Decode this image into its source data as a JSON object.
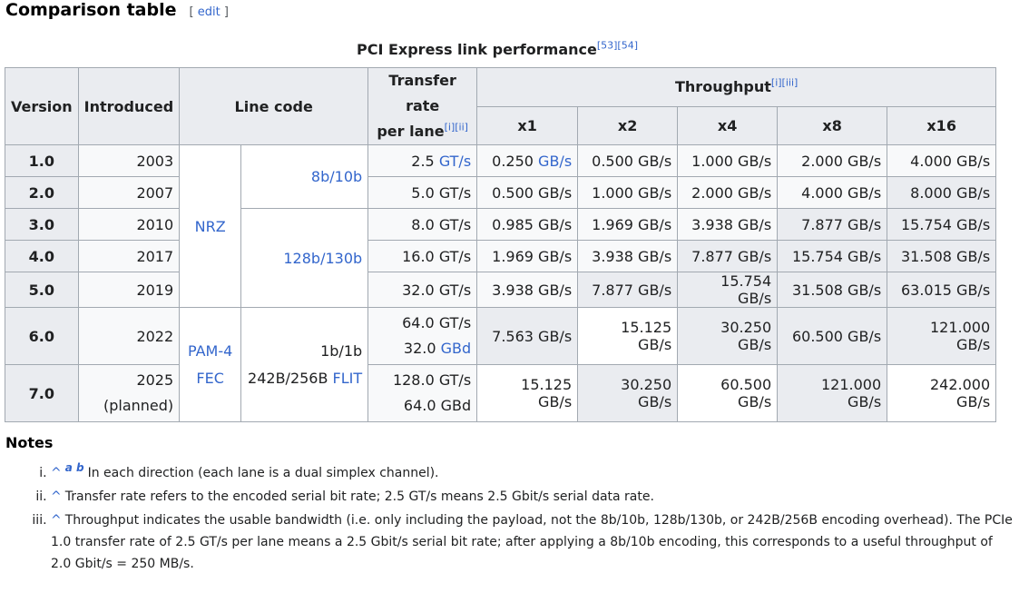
{
  "heading": {
    "title": "Comparison table",
    "edit_open": "[",
    "edit": "edit",
    "edit_close": "]"
  },
  "caption": {
    "text": "PCI Express link performance",
    "refs": "[53][54]"
  },
  "table": {
    "headers": {
      "version": "Version",
      "introduced": "Introduced",
      "line_code": "Line code",
      "transfer_rate_line1": "Transfer rate",
      "transfer_rate_line2": "per lane",
      "transfer_rate_refs": "[i][ii]",
      "throughput": "Throughput",
      "throughput_refs": "[i][iii]",
      "lanes": [
        "x1",
        "x2",
        "x4",
        "x8",
        "x16"
      ]
    },
    "groups": {
      "nrz": "NRZ",
      "pam4": "PAM-4",
      "fec": "FEC",
      "code_8b10b": "8b/10b",
      "code_128b130b": "128b/130b",
      "code_1b1b": "1b/1b",
      "code_242b_prefix": "242B/256B",
      "code_flit": "FLIT"
    },
    "rows": [
      {
        "version": "1.0",
        "year": "2003",
        "rate_num": "2.5",
        "rate_unit": "GT/s",
        "x1_num": "0.250",
        "x1_unit": "GB/s",
        "x2": "0.500 GB/s",
        "x4": "1.000 GB/s",
        "x8": "2.000 GB/s",
        "x16": "4.000 GB/s"
      },
      {
        "version": "2.0",
        "year": "2007",
        "rate": "5.0 GT/s",
        "x1": "0.500 GB/s",
        "x2": "1.000 GB/s",
        "x4": "2.000 GB/s",
        "x8": "4.000 GB/s",
        "x16": "8.000 GB/s"
      },
      {
        "version": "3.0",
        "year": "2010",
        "rate": "8.0 GT/s",
        "x1": "0.985 GB/s",
        "x2": "1.969 GB/s",
        "x4": "3.938 GB/s",
        "x8": "7.877 GB/s",
        "x16": "15.754 GB/s"
      },
      {
        "version": "4.0",
        "year": "2017",
        "rate": "16.0 GT/s",
        "x1": "1.969 GB/s",
        "x2": "3.938 GB/s",
        "x4": "7.877 GB/s",
        "x8": "15.754 GB/s",
        "x16": "31.508 GB/s"
      },
      {
        "version": "5.0",
        "year": "2019",
        "rate": "32.0 GT/s",
        "x1": "3.938 GB/s",
        "x2": "7.877 GB/s",
        "x4": "15.754 GB/s",
        "x8": "31.508 GB/s",
        "x16": "63.015 GB/s"
      },
      {
        "version": "6.0",
        "year": "2022",
        "rate_line1": "64.0 GT/s",
        "rate_line2_num": "32.0",
        "rate_line2_unit": "GBd",
        "x1": "7.563 GB/s",
        "x2": "15.125 GB/s",
        "x4": "30.250 GB/s",
        "x8": "60.500 GB/s",
        "x16": "121.000 GB/s"
      },
      {
        "version": "7.0",
        "year": "2025",
        "year_note": "(planned)",
        "rate_line1": "128.0 GT/s",
        "rate_line2": "64.0 GBd",
        "x1": "15.125 GB/s",
        "x2": "30.250 GB/s",
        "x4": "60.500 GB/s",
        "x8": "121.000 GB/s",
        "x16": "242.000 GB/s"
      }
    ]
  },
  "notes": {
    "title": "Notes",
    "caret": "^",
    "ab": "a b",
    "items": [
      "In each direction (each lane is a dual simplex channel).",
      "Transfer rate refers to the encoded serial bit rate; 2.5 GT/s means 2.5 Gbit/s serial data rate.",
      "Throughput indicates the usable bandwidth (i.e. only including the payload, not the 8b/10b, 128b/130b, or 242B/256B encoding overhead). The PCIe 1.0 transfer rate of 2.5 GT/s per lane means a 2.5 Gbit/s serial bit rate; after applying a 8b/10b encoding, this corresponds to a useful throughput of 2.0 Gbit/s = 250 MB/s."
    ]
  }
}
